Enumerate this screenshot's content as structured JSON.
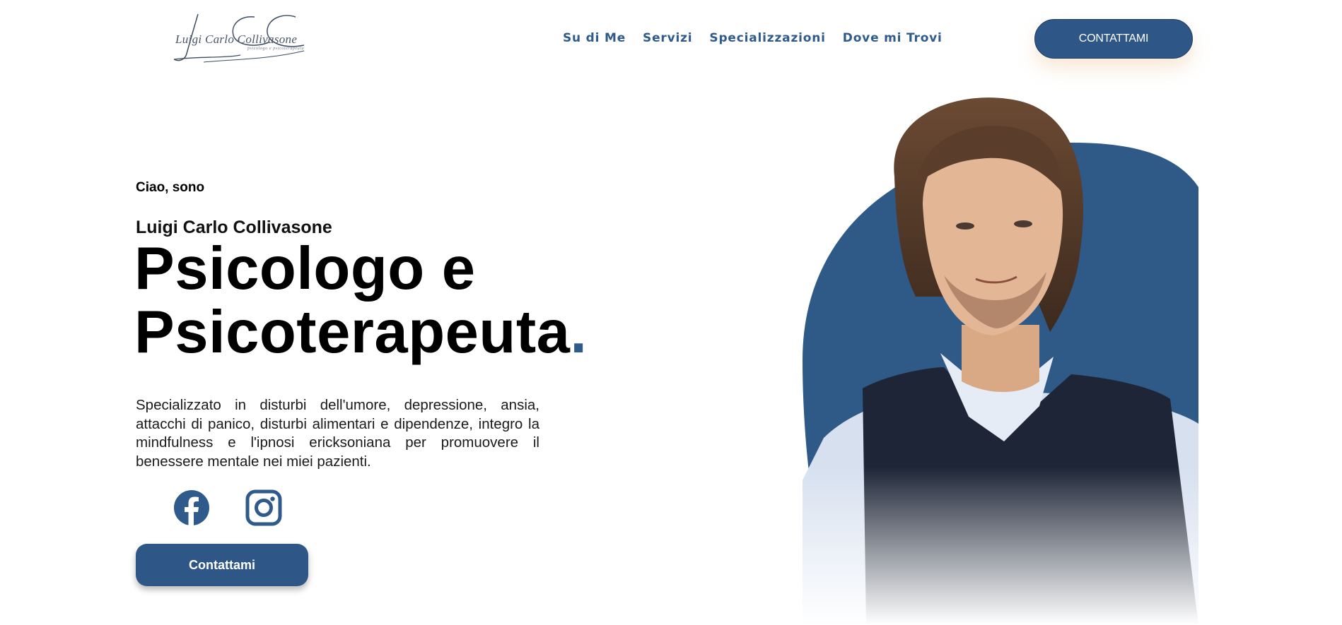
{
  "header": {
    "logo_text": "Luigi Carlo Collivasone",
    "logo_subtitle": "psicologo e psicoterapeuta",
    "nav": [
      "Su di Me",
      "Servizi",
      "Specializzazioni",
      "Dove mi Trovi"
    ],
    "cta_label": "CONTATTAMI"
  },
  "hero": {
    "greeting": "Ciao, sono",
    "name": "Luigi Carlo Collivasone",
    "headline_line1": "Psicologo e",
    "headline_line2": "Psicoterapeuta",
    "headline_dot": ".",
    "description": "Specializzato in disturbi dell'umore, depressione, ansia, attacchi di panico, disturbi alimentari e dipendenze, integro la mindfulness e l'ipnosi ericksoniana per promuovere il benessere mentale nei miei pazienti.",
    "social": [
      "facebook-icon",
      "instagram-icon"
    ],
    "cta_label": "Contattami"
  },
  "colors": {
    "brand_blue": "#2f5b8c",
    "button_blue": "#2e5687",
    "text": "#000000"
  }
}
